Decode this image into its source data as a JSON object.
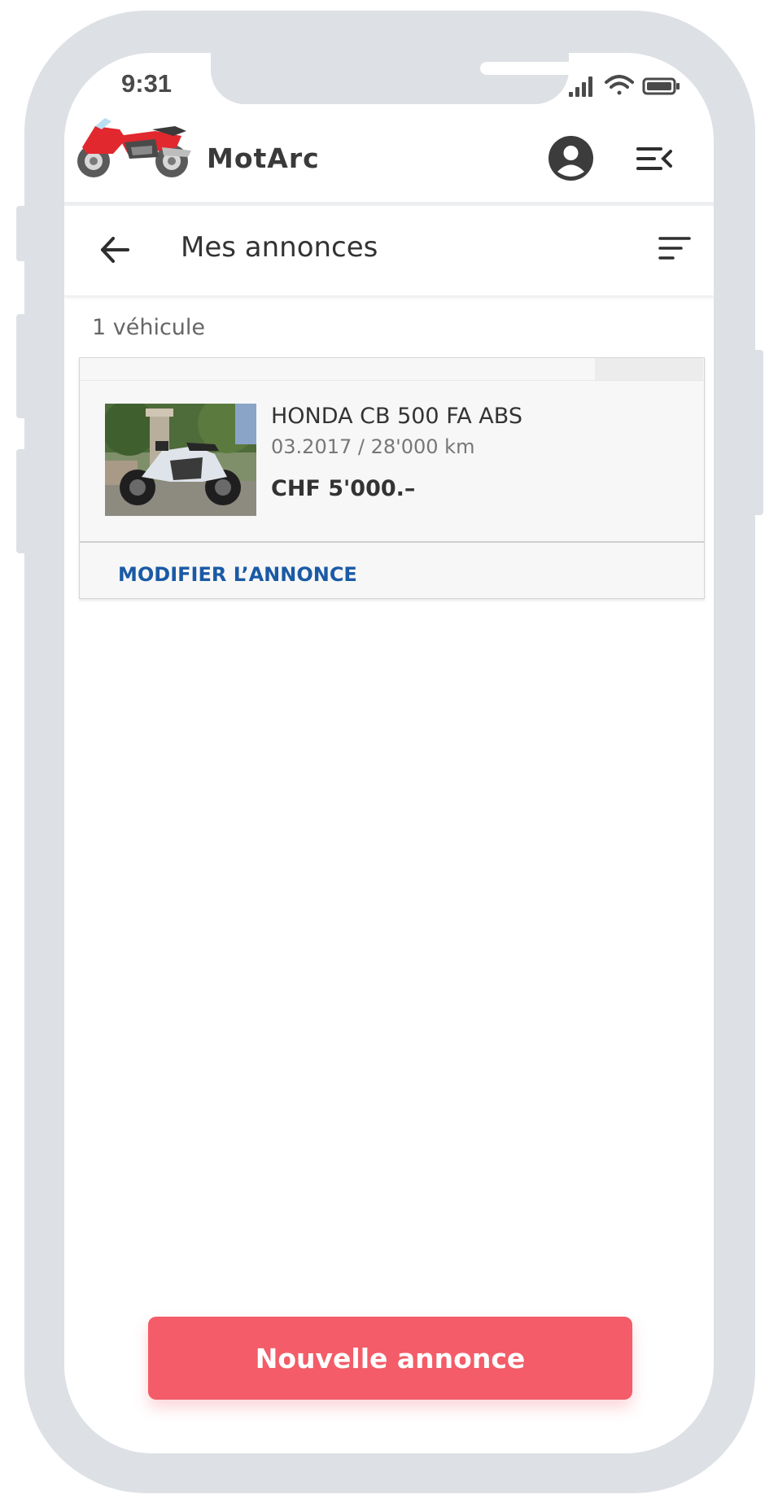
{
  "status_bar": {
    "time": "9:31"
  },
  "app": {
    "name": "MotArc"
  },
  "subheader": {
    "title": "Mes annonces"
  },
  "listing": {
    "count_label": "1 véhicule",
    "items": [
      {
        "title": "HONDA CB 500 FA ABS",
        "meta": "03.2017 / 28'000 km",
        "price": "CHF 5'000.–",
        "edit_label": "MODIFIER L’ANNONCE"
      }
    ]
  },
  "actions": {
    "new_listing_label": "Nouvelle annonce"
  },
  "colors": {
    "accent": "#f35c68",
    "link": "#1a5aa6",
    "frame": "#dde0e4"
  },
  "icons": {
    "logo": "motorcycle-logo",
    "account": "account-circle-icon",
    "menu": "menu-collapse-icon",
    "back": "back-arrow-icon",
    "sort": "sort-icon"
  }
}
